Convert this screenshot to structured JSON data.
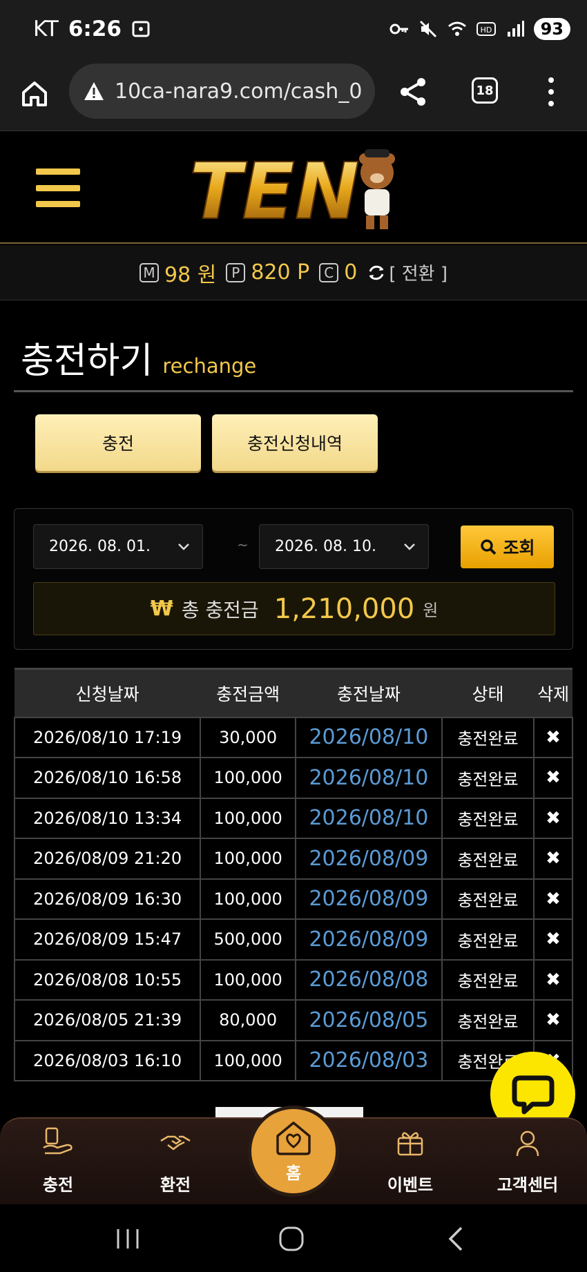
{
  "status_bar": {
    "carrier": "KT",
    "time": "6:26",
    "battery": "93"
  },
  "browser": {
    "url": "10ca-nara9.com/cash_0",
    "tab_count": "18"
  },
  "header": {
    "logo_text": "TEN"
  },
  "balance": {
    "money_badge": "M",
    "money_value": "98 원",
    "point_badge": "P",
    "point_value": "820 P",
    "coin_badge": "C",
    "coin_value": "0",
    "switch_label": "[ 전환 ]"
  },
  "page": {
    "title_ko": "충전하기",
    "title_en": "rechange"
  },
  "tabs": {
    "charge_label": "충전",
    "history_label": "충전신청내역"
  },
  "search": {
    "date_from": "2026. 08. 01.",
    "date_to": "2026. 08. 10.",
    "separator": "~",
    "button_label": "조회"
  },
  "total": {
    "symbol": "₩",
    "label": "총 충전금",
    "amount": "1,210,000",
    "unit": "원"
  },
  "table": {
    "headers": [
      "신청날짜",
      "충전금액",
      "충전날짜",
      "상태",
      "삭제"
    ],
    "rows": [
      {
        "requested": "2026/08/10 17:19",
        "amount": "30,000",
        "charged": "2026/08/10",
        "status": "충전완료",
        "delete": "✖"
      },
      {
        "requested": "2026/08/10 16:58",
        "amount": "100,000",
        "charged": "2026/08/10",
        "status": "충전완료",
        "delete": "✖"
      },
      {
        "requested": "2026/08/10 13:34",
        "amount": "100,000",
        "charged": "2026/08/10",
        "status": "충전완료",
        "delete": "✖"
      },
      {
        "requested": "2026/08/09 21:20",
        "amount": "100,000",
        "charged": "2026/08/09",
        "status": "충전완료",
        "delete": "✖"
      },
      {
        "requested": "2026/08/09 16:30",
        "amount": "100,000",
        "charged": "2026/08/09",
        "status": "충전완료",
        "delete": "✖"
      },
      {
        "requested": "2026/08/09 15:47",
        "amount": "500,000",
        "charged": "2026/08/09",
        "status": "충전완료",
        "delete": "✖"
      },
      {
        "requested": "2026/08/08 10:55",
        "amount": "100,000",
        "charged": "2026/08/08",
        "status": "충전완료",
        "delete": "✖"
      },
      {
        "requested": "2026/08/05 21:39",
        "amount": "80,000",
        "charged": "2026/08/05",
        "status": "충전완료",
        "delete": "✖"
      },
      {
        "requested": "2026/08/03 16:10",
        "amount": "100,000",
        "charged": "2026/08/03",
        "status": "충전완료",
        "delete": "✖"
      }
    ]
  },
  "bottom_nav": {
    "charge": "충전",
    "exchange": "환전",
    "home": "홈",
    "event": "이벤트",
    "support": "고객센터"
  },
  "colors": {
    "gold": "#f2c84b",
    "link_blue": "#5b9bd5",
    "chat_yellow": "#fce600",
    "home_orange": "#e8a23a"
  }
}
